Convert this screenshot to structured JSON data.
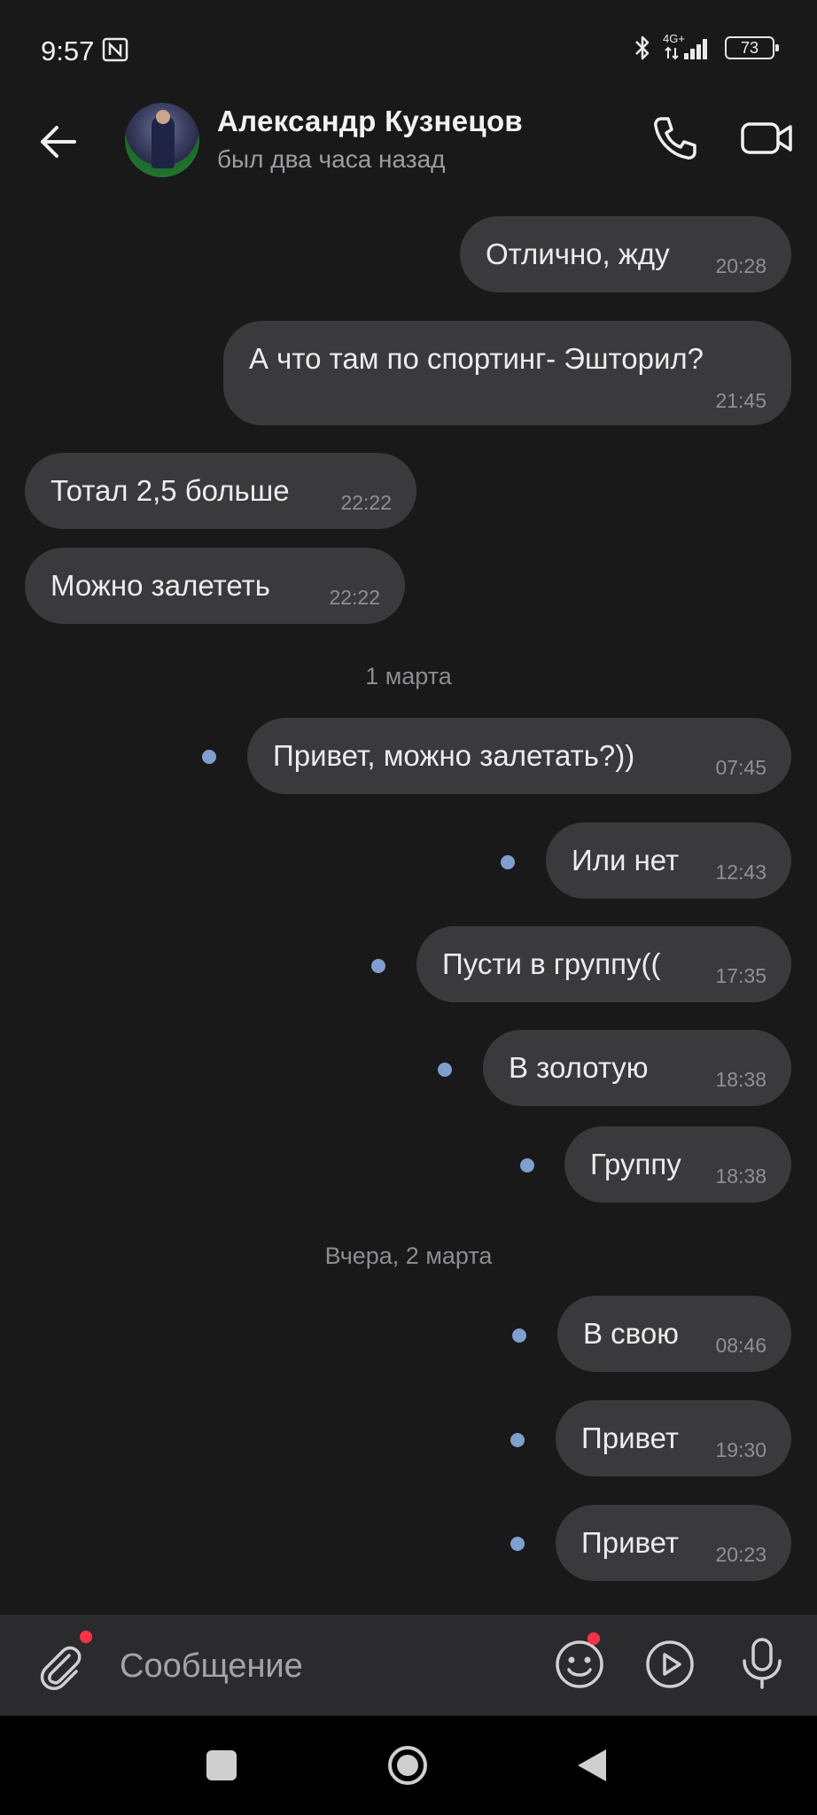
{
  "status_bar": {
    "time": "9:57",
    "network": "4G+",
    "battery": "73"
  },
  "header": {
    "contact_name": "Александр Кузнецов",
    "contact_status": "был два часа назад"
  },
  "messages": [
    {
      "text": "Отлично, жду",
      "time": "20:28",
      "direction": "out",
      "unread": false
    },
    {
      "text": "А что там по спортинг- Эшторил?",
      "time": "21:45",
      "direction": "out",
      "unread": false
    },
    {
      "text": "Тотал 2,5 больше",
      "time": "22:22",
      "direction": "in",
      "unread": false
    },
    {
      "text": "Можно залететь",
      "time": "22:22",
      "direction": "in",
      "unread": false
    },
    {
      "date_separator": "1 марта"
    },
    {
      "text": "Привет, можно залетать?))",
      "time": "07:45",
      "direction": "out",
      "unread": true
    },
    {
      "text": "Или нет",
      "time": "12:43",
      "direction": "out",
      "unread": true
    },
    {
      "text": "Пусти в группу((",
      "time": "17:35",
      "direction": "out",
      "unread": true
    },
    {
      "text": "В золотую",
      "time": "18:38",
      "direction": "out",
      "unread": true
    },
    {
      "text": "Группу",
      "time": "18:38",
      "direction": "out",
      "unread": true
    },
    {
      "date_separator": "Вчера, 2 марта"
    },
    {
      "text": "В свою",
      "time": "08:46",
      "direction": "out",
      "unread": true
    },
    {
      "text": "Привет",
      "time": "19:30",
      "direction": "out",
      "unread": true
    },
    {
      "text": "Привет",
      "time": "20:23",
      "direction": "out",
      "unread": true
    }
  ],
  "composer": {
    "placeholder": "Сообщение"
  },
  "colors": {
    "background": "#19191a",
    "bubble": "#3a3a3c",
    "unread_dot": "#7f9fcf",
    "badge": "#ff3347"
  },
  "icons": [
    "nfc-icon",
    "bluetooth-icon",
    "signal-icon",
    "battery-icon",
    "back-arrow-icon",
    "phone-icon",
    "video-camera-icon",
    "paperclip-icon",
    "emoji-icon",
    "play-icon",
    "microphone-icon",
    "nav-recents-icon",
    "nav-home-icon",
    "nav-back-icon"
  ]
}
